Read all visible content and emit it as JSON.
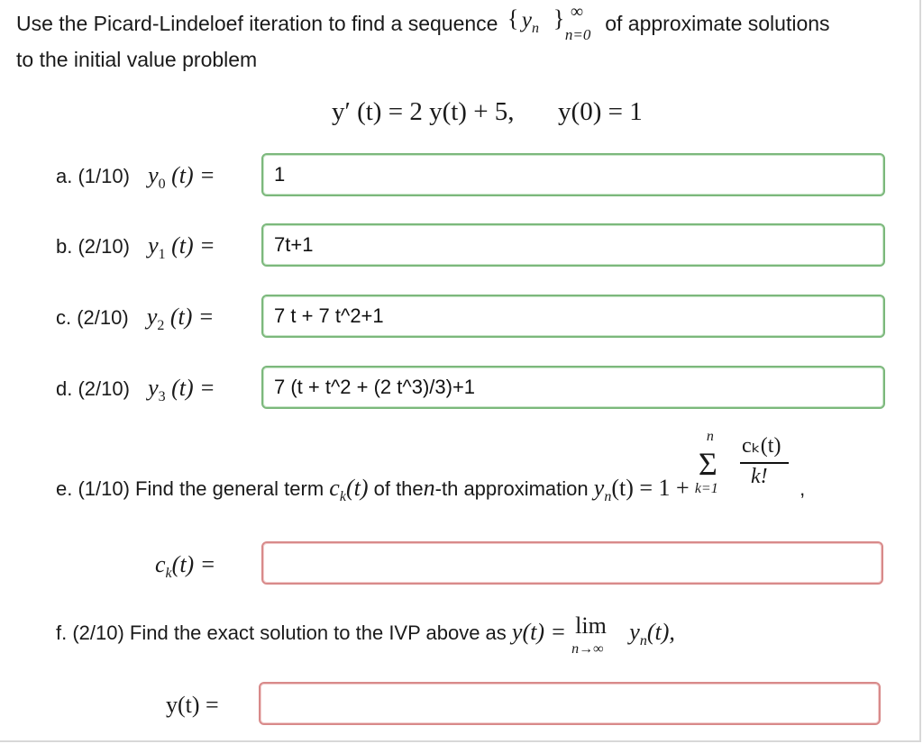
{
  "intro": {
    "text_before": "Use the Picard-Lindeloef iteration to find a sequence",
    "seq_open": "{",
    "seq_var": "y",
    "seq_var_sub": "n",
    "seq_close": "}",
    "seq_sup": "∞",
    "seq_sub": "n=0",
    "text_after": "of approximate solutions",
    "line2": "to the initial value problem"
  },
  "ivp": {
    "equation": "y′ (t) = 2 y(t) + 5,",
    "initial": "y(0) = 1"
  },
  "rows": [
    {
      "part": "a. (1/10)",
      "var": "y",
      "sub": "0",
      "arg": "(t) =",
      "value": "1",
      "status": "correct"
    },
    {
      "part": "b. (2/10)",
      "var": "y",
      "sub": "1",
      "arg": "(t) =",
      "value": "7t+1",
      "status": "correct"
    },
    {
      "part": "c. (2/10)",
      "var": "y",
      "sub": "2",
      "arg": "(t) =",
      "value": "7 t + 7 t^2+1",
      "status": "correct"
    },
    {
      "part": "d. (2/10)",
      "var": "y",
      "sub": "3",
      "arg": "(t) =",
      "value": "7 (t + t^2 + (2 t^3)/3)+1",
      "status": "correct"
    }
  ],
  "part_e": {
    "text": "e. (1/10) Find the general term",
    "term": "c",
    "term_sub": "k",
    "term_arg": "(t)",
    "text_mid": "of the",
    "n_var": "n",
    "text_mid2": "-th approximation",
    "approx_lhs": "y",
    "approx_sub": "n",
    "approx_rhs": "(t) = 1 +",
    "sum_top": "n",
    "sum_symbol": "Σ",
    "sum_bottom": "k=1",
    "frac_num": "cₖ(t)",
    "frac_den": "k!",
    "trailing": ",",
    "answer_label_var": "c",
    "answer_label_sub": "k",
    "answer_label_rest": "(t) =",
    "answer_value": "",
    "answer_status": "wrong"
  },
  "part_f": {
    "text": "f. (2/10) Find the exact solution to the IVP above as",
    "lhs": "y(t) =",
    "lim_word": "lim",
    "lim_under": "n→∞",
    "rhs_var": "y",
    "rhs_sub": "n",
    "rhs_rest": "(t),",
    "answer_label": "y(t) =",
    "answer_value": "",
    "answer_status": "wrong"
  }
}
